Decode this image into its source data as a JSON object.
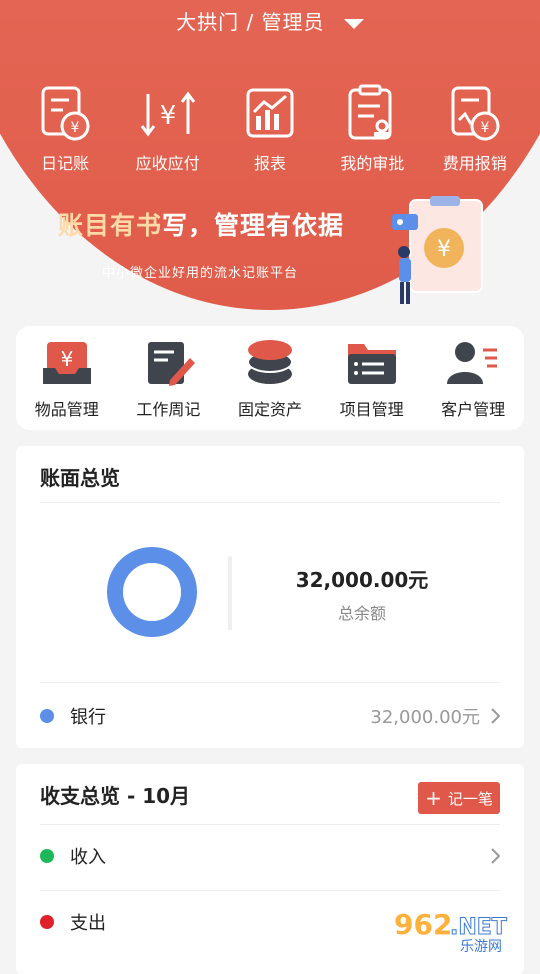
{
  "header": {
    "org": "大拱门",
    "sep": " / ",
    "role": "管理员"
  },
  "quick_actions": [
    {
      "label": "日记账",
      "icon": "journal-icon"
    },
    {
      "label": "应收应付",
      "icon": "receivable-payable-icon"
    },
    {
      "label": "报表",
      "icon": "report-icon"
    },
    {
      "label": "我的审批",
      "icon": "approval-icon"
    },
    {
      "label": "费用报销",
      "icon": "expense-reimburse-icon"
    }
  ],
  "banner": {
    "slogan_part1": "账目",
    "slogan_part2": "有书",
    "slogan_part3": "写，管理有依据",
    "subtitle": "中小微企业好用的流水记账平台"
  },
  "menu": [
    {
      "label": "物品管理",
      "icon": "goods-icon"
    },
    {
      "label": "工作周记",
      "icon": "weekly-note-icon"
    },
    {
      "label": "固定资产",
      "icon": "fixed-assets-icon"
    },
    {
      "label": "项目管理",
      "icon": "project-folder-icon"
    },
    {
      "label": "客户管理",
      "icon": "customer-icon"
    }
  ],
  "overview": {
    "title": "账面总览",
    "total": "32,000.00元",
    "total_label": "总余额",
    "accounts": [
      {
        "name": "银行",
        "amount": "32,000.00元",
        "color": "#5b8fe8"
      }
    ]
  },
  "flow": {
    "title": "收支总览 - 10月",
    "record_label": "记一笔",
    "rows": [
      {
        "name": "收入",
        "color": "#1fb858"
      },
      {
        "name": "支出",
        "color": "#e0202a"
      }
    ]
  },
  "watermark": {
    "brand": "962",
    "domain": ".NET",
    "cn": "乐游网"
  },
  "colors": {
    "primary": "#e05b4a",
    "accent_gold": "#ffd9a8",
    "donut": "#5b8fe8"
  }
}
